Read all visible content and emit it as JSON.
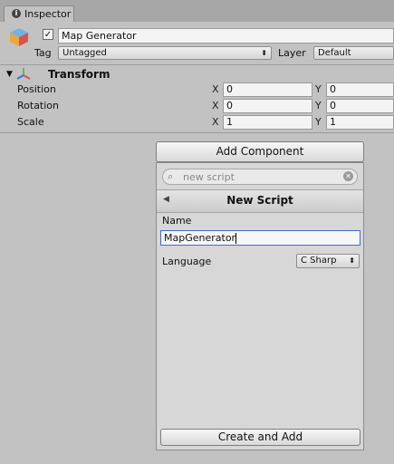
{
  "tab": {
    "label": "Inspector"
  },
  "object": {
    "name": "Map Generator",
    "active": true,
    "tag_label": "Tag",
    "tag_value": "Untagged",
    "layer_label": "Layer",
    "layer_value": "Default"
  },
  "transform": {
    "title": "Transform",
    "rows": [
      {
        "label": "Position",
        "x": "0",
        "y": "0"
      },
      {
        "label": "Rotation",
        "x": "0",
        "y": "0"
      },
      {
        "label": "Scale",
        "x": "1",
        "y": "1"
      }
    ],
    "x_axis": "X",
    "y_axis": "Y"
  },
  "add_component": {
    "label": "Add Component"
  },
  "search": {
    "placeholder": "new script"
  },
  "new_script": {
    "title": "New Script",
    "name_label": "Name",
    "name_value": "MapGenerator",
    "language_label": "Language",
    "language_value": "C Sharp",
    "create_label": "Create and Add"
  },
  "colors": {
    "accent": "#3c6fd6",
    "panel": "#d7d7d7"
  },
  "icons": {
    "tab": "info-icon",
    "object": "gameobject-cube-icon",
    "transform": "transform-axes-icon"
  }
}
